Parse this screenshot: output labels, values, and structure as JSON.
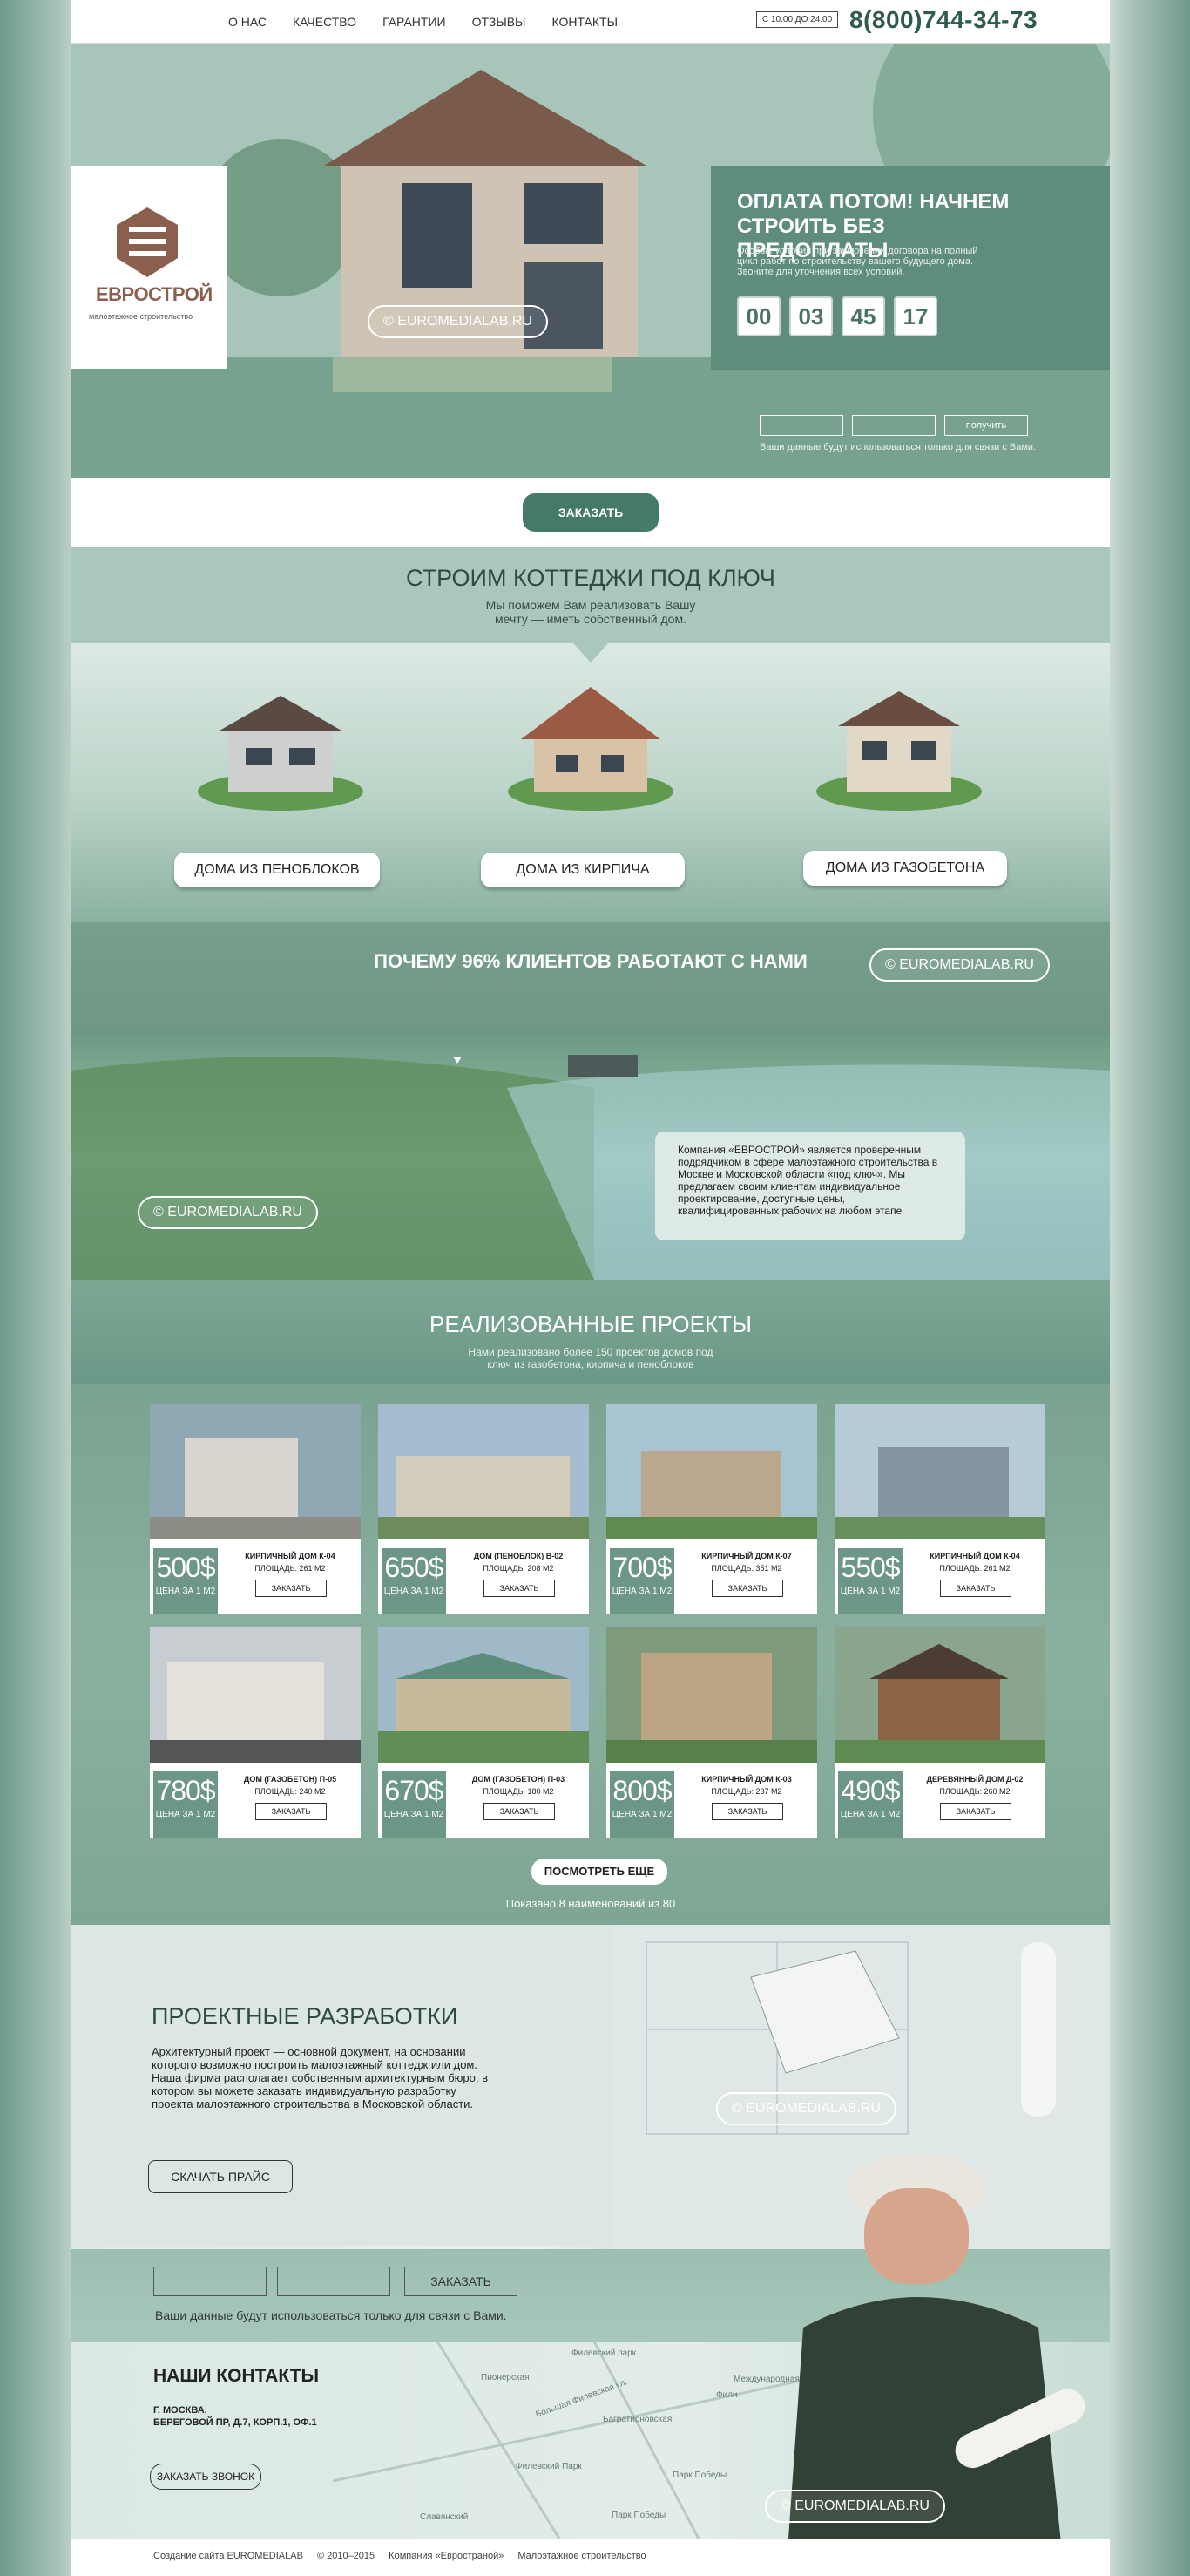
{
  "nav": {
    "items": [
      "О НАС",
      "КАЧЕСТВО",
      "ГАРАНТИИ",
      "ОТЗЫВЫ",
      "КОНТАКТЫ"
    ],
    "hours": "С 10.00 ДО 24.00",
    "phone": "8(800)744-34-73"
  },
  "logo": {
    "name": "ЕВРОСТРОЙ",
    "subtitle": "малоэтажное строительство"
  },
  "offer": {
    "title": "ОПЛАТА ПОТОМ! НАЧНЕМ СТРОИТЬ БЕЗ ПРЕДОПЛАТЫ",
    "text": "Особые условия при заключении договора на полный цикл работ по строительству вашего будущего дома. Звоните для уточнения всех условий.",
    "timer": [
      "00",
      "03",
      "45",
      "17"
    ]
  },
  "form1": {
    "button": "получить",
    "note": "Ваши данные будут использоваться только для связи с Вами."
  },
  "watermark": "© EUROMEDIALAB.RU",
  "order_button": "ЗАКАЗАТЬ",
  "turnkey": {
    "title": "СТРОИМ КОТТЕДЖИ ПОД КЛЮЧ",
    "subtitle_line1": "Мы поможем Вам реализовать Вашу",
    "subtitle_line2": "мечту — иметь собственный дом."
  },
  "types": [
    "ДОМА ИЗ ПЕНОБЛОКОВ",
    "ДОМА ИЗ КИРПИЧА",
    "ДОМА ИЗ ГАЗОБЕТОНА"
  ],
  "why": "ПОЧЕМУ 96% КЛИЕНТОВ РАБОТАЮТ С НАМИ",
  "about": "Компания «ЕВРОСТРОЙ» является проверенным подрядчиком в сфере малоэтажного строительства в Москве и Московской области «под ключ». Мы предлагаем своим клиентам индивидуальное проектирование, доступные цены, квалифицированных рабочих на любом этапе",
  "projects": {
    "title": "РЕАЛИЗОВАННЫЕ ПРОЕКТЫ",
    "subtitle_line1": "Нами реализовано более 150 проектов домов под",
    "subtitle_line2": "ключ из газобетона, кирпича и пеноблоков",
    "price_unit": "ЦЕНА ЗА 1 М2",
    "order_label": "ЗАКАЗАТЬ",
    "items": [
      {
        "price": "500$",
        "name": "КИРПИЧНЫЙ ДОМ К-04",
        "area": "ПЛОЩАДЬ: 261 М2"
      },
      {
        "price": "650$",
        "name": "ДОМ (ПЕНОБЛОК) В-02",
        "area": "ПЛОЩАДЬ: 208 М2"
      },
      {
        "price": "700$",
        "name": "КИРПИЧНЫЙ ДОМ К-07",
        "area": "ПЛОЩАДЬ: 351 М2"
      },
      {
        "price": "550$",
        "name": "КИРПИЧНЫЙ ДОМ К-04",
        "area": "ПЛОЩАДЬ: 261 М2"
      },
      {
        "price": "780$",
        "name": "ДОМ (ГАЗОБЕТОН) П-05",
        "area": "ПЛОЩАДЬ: 240 М2"
      },
      {
        "price": "670$",
        "name": "ДОМ (ГАЗОБЕТОН) П-03",
        "area": "ПЛОЩАДЬ: 180 М2"
      },
      {
        "price": "800$",
        "name": "КИРПИЧНЫЙ ДОМ К-03",
        "area": "ПЛОЩАДЬ: 237 М2"
      },
      {
        "price": "490$",
        "name": "ДЕРЕВЯННЫЙ ДОМ Д-02",
        "area": "ПЛОЩАДЬ: 260 М2"
      }
    ],
    "more_button": "ПОСМОТРЕТЬ ЕЩЕ",
    "shown": "Показано 8 наименований из 80"
  },
  "design": {
    "title": "ПРОЕКТНЫЕ РАЗРАБОТКИ",
    "text": "Архитектурный проект — основной документ, на основании которого возможно построить малоэтажный коттедж или дом. Наша фирма располагает собственным архитектурным бюро, в котором вы можете заказать индивидуальную разработку проекта малоэтажного строительства в Московской области.",
    "button": "СКАЧАТЬ ПРАЙС"
  },
  "form2": {
    "button": "ЗАКАЗАТЬ",
    "note": "Ваши данные будут использоваться только для связи с Вами."
  },
  "contacts": {
    "title": "НАШИ КОНТАКТЫ",
    "line1": "Г. МОСКВА,",
    "line2": "БЕРЕГОВОЙ ПР, Д.7, КОРП.1, ОФ.1",
    "button": "ЗАКАЗАТЬ ЗВОНОК"
  },
  "map_labels": [
    "Филевский парк",
    "Пионерская",
    "Большая Филевская ул.",
    "Багратионовская",
    "Филевский Парк",
    "Фили",
    "Международная",
    "Парк Победы",
    "Славянский",
    "Парк Победы"
  ],
  "footer": {
    "credit": "Создание сайта EUROMEDIALAB",
    "copy": "© 2010–2015",
    "company": "Компания «Евространой»",
    "company_note": "Малоэтажное строительство"
  }
}
